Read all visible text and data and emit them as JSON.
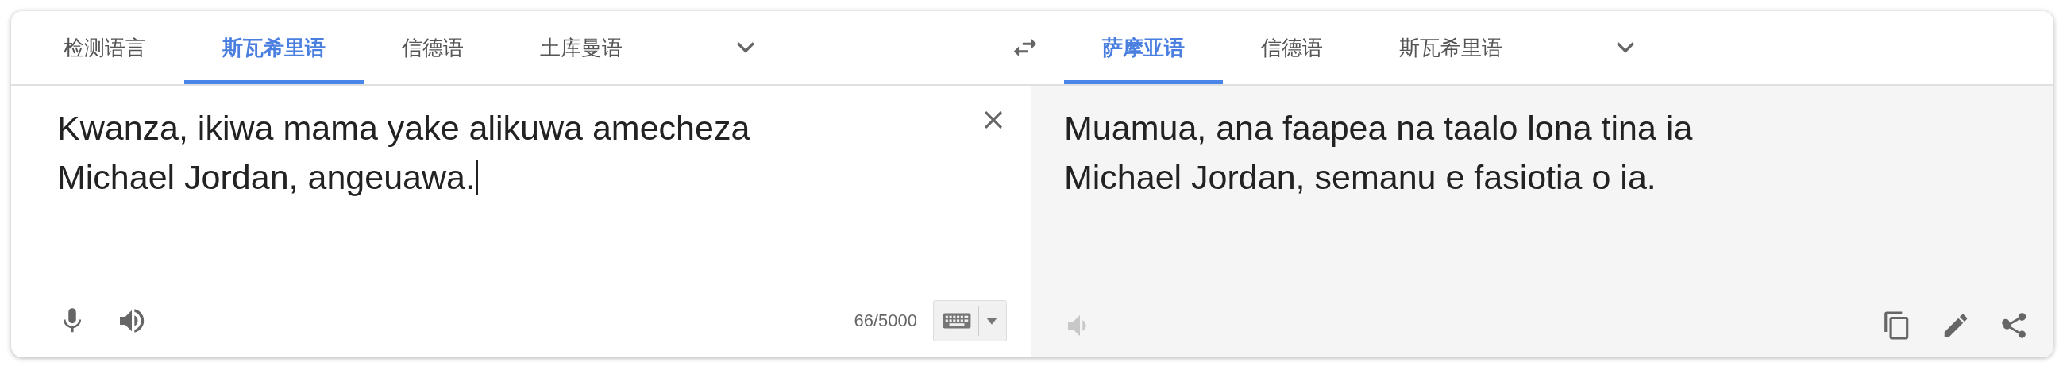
{
  "source": {
    "tabs": [
      {
        "label": "检测语言",
        "selected": false
      },
      {
        "label": "斯瓦希里语",
        "selected": true
      },
      {
        "label": "信德语",
        "selected": false
      },
      {
        "label": "土库曼语",
        "selected": false
      }
    ],
    "text": "Kwanza, ikiwa mama yake alikuwa amecheza Michael Jordan, angeuawa.",
    "counter": "66/5000"
  },
  "target": {
    "tabs": [
      {
        "label": "萨摩亚语",
        "selected": true
      },
      {
        "label": "信德语",
        "selected": false
      },
      {
        "label": "斯瓦希里语",
        "selected": false
      }
    ],
    "text": "Muamua, ana faapea na taalo lona tina ia Michael Jordan, semanu e fasiotia o ia.",
    "listen_disabled": true
  }
}
